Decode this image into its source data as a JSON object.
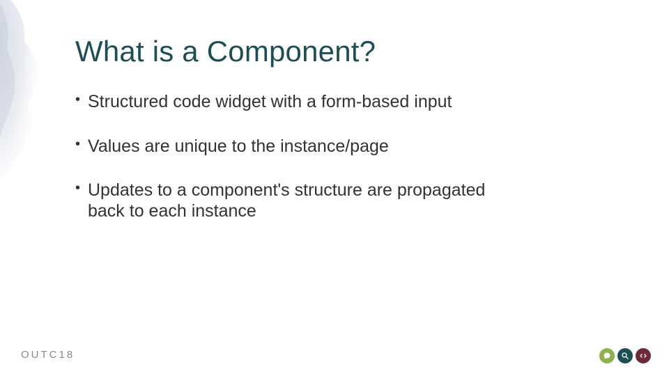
{
  "slide": {
    "title": "What is a Component?",
    "bullets": [
      "Structured code widget with a form-based input",
      "Values are unique to the instance/page",
      "Updates to a component's structure are propagated back to each instance"
    ]
  },
  "footer": {
    "brand": "OUTC18"
  },
  "colors": {
    "title": "#1d4e56",
    "badge_green": "#8fb04e",
    "badge_teal": "#1d4e56",
    "badge_maroon": "#6d2a3a"
  }
}
